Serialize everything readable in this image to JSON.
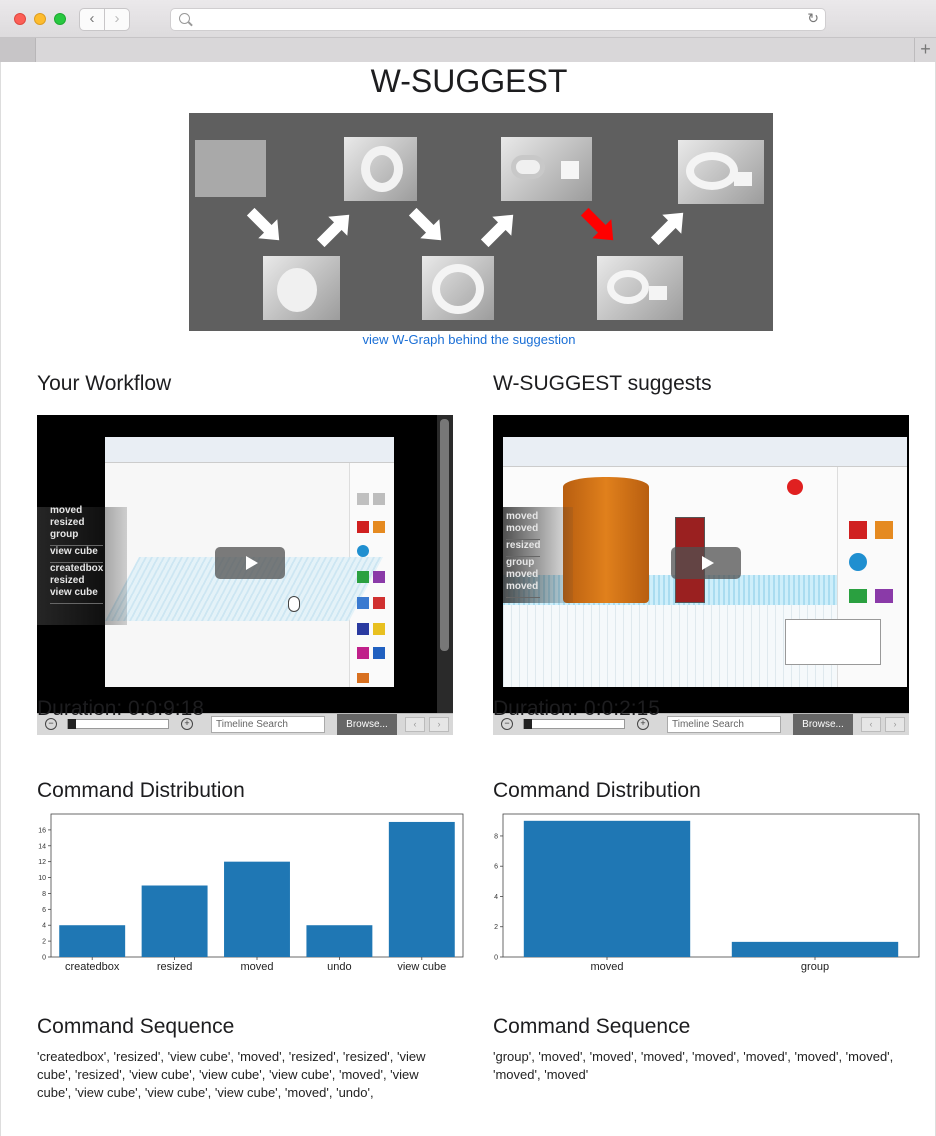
{
  "page_title": "W-SUGGEST",
  "hero_link": "view W-Graph behind the suggestion",
  "left": {
    "heading": "Your Workflow",
    "video": {
      "timeline_placeholder": "Timeline Search",
      "browse_label": "Browse...",
      "command_groups": [
        [
          "moved",
          "resized",
          "group"
        ],
        [
          "view cube"
        ],
        [
          "createdbox",
          "resized",
          "view cube"
        ]
      ]
    },
    "duration": "Duration: 0:0:9:18",
    "dist_heading": "Command Distribution",
    "seq_heading": "Command Sequence",
    "sequence": "'createdbox', 'resized', 'view cube', 'moved', 'resized', 'resized', 'view cube', 'resized', 'view cube', 'view cube', 'view cube', 'moved', 'view cube', 'view cube', 'view cube', 'view cube', 'moved', 'undo',"
  },
  "right": {
    "heading": "W-SUGGEST suggests",
    "video": {
      "timeline_placeholder": "Timeline Search",
      "browse_label": "Browse...",
      "command_groups": [
        [
          "moved",
          "moved"
        ],
        [
          "resized"
        ],
        [
          "group",
          "moved",
          "moved"
        ]
      ]
    },
    "duration": "Duration: 0:0:2:15",
    "dist_heading": "Command Distribution",
    "seq_heading": "Command Sequence",
    "sequence": "'group', 'moved', 'moved', 'moved', 'moved', 'moved', 'moved', 'moved', 'moved', 'moved'"
  },
  "colors": {
    "bar": "#1f77b4",
    "link": "#1a6fd6",
    "arrow": "#ffffff",
    "arrow_highlight": "#ff0000"
  },
  "chart_data": [
    {
      "type": "bar",
      "categories": [
        "createdbox",
        "resized",
        "moved",
        "undo",
        "view cube"
      ],
      "values": [
        4,
        9,
        12,
        4,
        17
      ],
      "yticks": [
        0,
        2,
        4,
        6,
        8,
        10,
        12,
        14,
        16
      ],
      "ylim": [
        0,
        18
      ],
      "title": "",
      "xlabel": "",
      "ylabel": ""
    },
    {
      "type": "bar",
      "categories": [
        "moved",
        "group"
      ],
      "values": [
        9,
        1
      ],
      "yticks": [
        0,
        2,
        4,
        6,
        8
      ],
      "ylim": [
        0,
        9.45
      ],
      "title": "",
      "xlabel": "",
      "ylabel": ""
    }
  ]
}
